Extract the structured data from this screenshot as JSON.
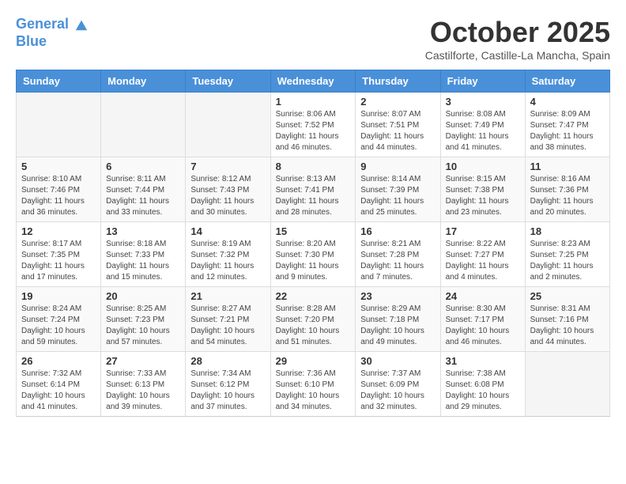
{
  "header": {
    "logo_line1": "General",
    "logo_line2": "Blue",
    "month": "October 2025",
    "location": "Castilforte, Castille-La Mancha, Spain"
  },
  "days_of_week": [
    "Sunday",
    "Monday",
    "Tuesday",
    "Wednesday",
    "Thursday",
    "Friday",
    "Saturday"
  ],
  "weeks": [
    [
      {
        "day": "",
        "info": ""
      },
      {
        "day": "",
        "info": ""
      },
      {
        "day": "",
        "info": ""
      },
      {
        "day": "1",
        "info": "Sunrise: 8:06 AM\nSunset: 7:52 PM\nDaylight: 11 hours and 46 minutes."
      },
      {
        "day": "2",
        "info": "Sunrise: 8:07 AM\nSunset: 7:51 PM\nDaylight: 11 hours and 44 minutes."
      },
      {
        "day": "3",
        "info": "Sunrise: 8:08 AM\nSunset: 7:49 PM\nDaylight: 11 hours and 41 minutes."
      },
      {
        "day": "4",
        "info": "Sunrise: 8:09 AM\nSunset: 7:47 PM\nDaylight: 11 hours and 38 minutes."
      }
    ],
    [
      {
        "day": "5",
        "info": "Sunrise: 8:10 AM\nSunset: 7:46 PM\nDaylight: 11 hours and 36 minutes."
      },
      {
        "day": "6",
        "info": "Sunrise: 8:11 AM\nSunset: 7:44 PM\nDaylight: 11 hours and 33 minutes."
      },
      {
        "day": "7",
        "info": "Sunrise: 8:12 AM\nSunset: 7:43 PM\nDaylight: 11 hours and 30 minutes."
      },
      {
        "day": "8",
        "info": "Sunrise: 8:13 AM\nSunset: 7:41 PM\nDaylight: 11 hours and 28 minutes."
      },
      {
        "day": "9",
        "info": "Sunrise: 8:14 AM\nSunset: 7:39 PM\nDaylight: 11 hours and 25 minutes."
      },
      {
        "day": "10",
        "info": "Sunrise: 8:15 AM\nSunset: 7:38 PM\nDaylight: 11 hours and 23 minutes."
      },
      {
        "day": "11",
        "info": "Sunrise: 8:16 AM\nSunset: 7:36 PM\nDaylight: 11 hours and 20 minutes."
      }
    ],
    [
      {
        "day": "12",
        "info": "Sunrise: 8:17 AM\nSunset: 7:35 PM\nDaylight: 11 hours and 17 minutes."
      },
      {
        "day": "13",
        "info": "Sunrise: 8:18 AM\nSunset: 7:33 PM\nDaylight: 11 hours and 15 minutes."
      },
      {
        "day": "14",
        "info": "Sunrise: 8:19 AM\nSunset: 7:32 PM\nDaylight: 11 hours and 12 minutes."
      },
      {
        "day": "15",
        "info": "Sunrise: 8:20 AM\nSunset: 7:30 PM\nDaylight: 11 hours and 9 minutes."
      },
      {
        "day": "16",
        "info": "Sunrise: 8:21 AM\nSunset: 7:28 PM\nDaylight: 11 hours and 7 minutes."
      },
      {
        "day": "17",
        "info": "Sunrise: 8:22 AM\nSunset: 7:27 PM\nDaylight: 11 hours and 4 minutes."
      },
      {
        "day": "18",
        "info": "Sunrise: 8:23 AM\nSunset: 7:25 PM\nDaylight: 11 hours and 2 minutes."
      }
    ],
    [
      {
        "day": "19",
        "info": "Sunrise: 8:24 AM\nSunset: 7:24 PM\nDaylight: 10 hours and 59 minutes."
      },
      {
        "day": "20",
        "info": "Sunrise: 8:25 AM\nSunset: 7:23 PM\nDaylight: 10 hours and 57 minutes."
      },
      {
        "day": "21",
        "info": "Sunrise: 8:27 AM\nSunset: 7:21 PM\nDaylight: 10 hours and 54 minutes."
      },
      {
        "day": "22",
        "info": "Sunrise: 8:28 AM\nSunset: 7:20 PM\nDaylight: 10 hours and 51 minutes."
      },
      {
        "day": "23",
        "info": "Sunrise: 8:29 AM\nSunset: 7:18 PM\nDaylight: 10 hours and 49 minutes."
      },
      {
        "day": "24",
        "info": "Sunrise: 8:30 AM\nSunset: 7:17 PM\nDaylight: 10 hours and 46 minutes."
      },
      {
        "day": "25",
        "info": "Sunrise: 8:31 AM\nSunset: 7:16 PM\nDaylight: 10 hours and 44 minutes."
      }
    ],
    [
      {
        "day": "26",
        "info": "Sunrise: 7:32 AM\nSunset: 6:14 PM\nDaylight: 10 hours and 41 minutes."
      },
      {
        "day": "27",
        "info": "Sunrise: 7:33 AM\nSunset: 6:13 PM\nDaylight: 10 hours and 39 minutes."
      },
      {
        "day": "28",
        "info": "Sunrise: 7:34 AM\nSunset: 6:12 PM\nDaylight: 10 hours and 37 minutes."
      },
      {
        "day": "29",
        "info": "Sunrise: 7:36 AM\nSunset: 6:10 PM\nDaylight: 10 hours and 34 minutes."
      },
      {
        "day": "30",
        "info": "Sunrise: 7:37 AM\nSunset: 6:09 PM\nDaylight: 10 hours and 32 minutes."
      },
      {
        "day": "31",
        "info": "Sunrise: 7:38 AM\nSunset: 6:08 PM\nDaylight: 10 hours and 29 minutes."
      },
      {
        "day": "",
        "info": ""
      }
    ]
  ]
}
